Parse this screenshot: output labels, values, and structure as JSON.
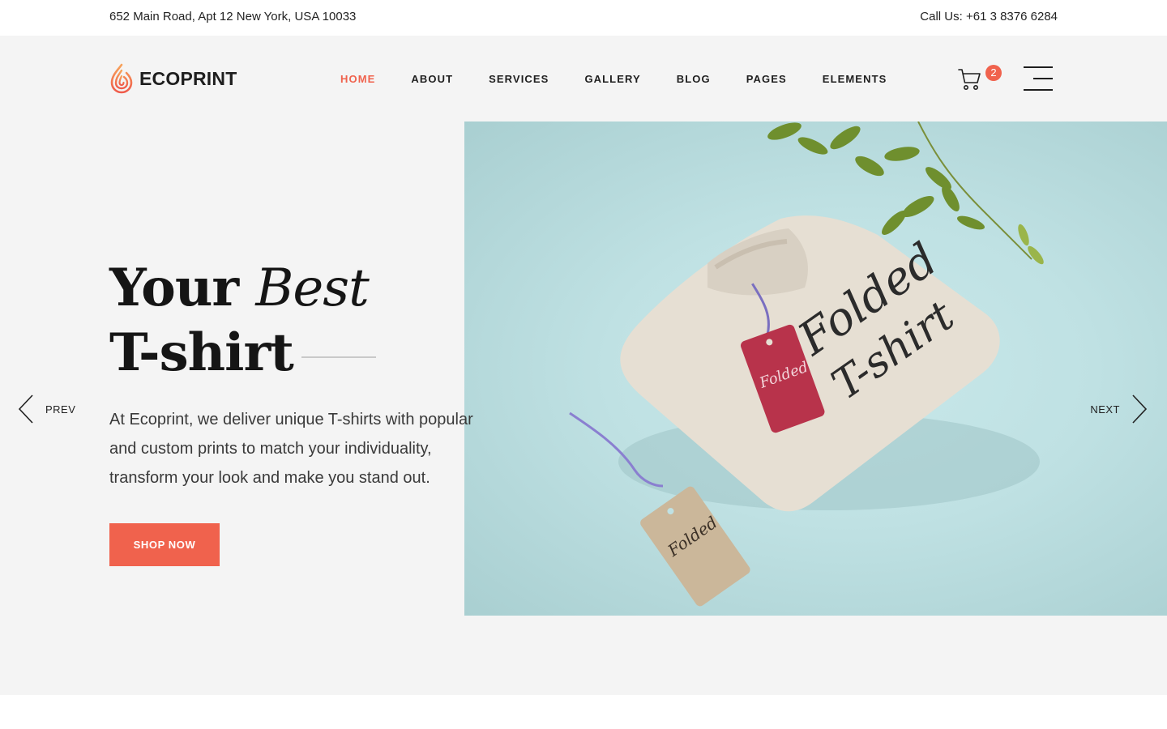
{
  "topbar": {
    "address": "652 Main Road, Apt 12 New York, USA 10033",
    "phone": "Call Us: +61 3 8376 6284"
  },
  "brand": {
    "name": "ECOPRINT",
    "logo_icon": "flame-drop-icon",
    "accent_color": "#f0624d"
  },
  "nav": {
    "items": [
      {
        "label": "HOME",
        "active": true
      },
      {
        "label": "ABOUT"
      },
      {
        "label": "SERVICES"
      },
      {
        "label": "GALLERY"
      },
      {
        "label": "BLOG"
      },
      {
        "label": "PAGES"
      },
      {
        "label": "ELEMENTS"
      }
    ]
  },
  "cart": {
    "count": "2",
    "icon": "cart-icon"
  },
  "menu": {
    "icon": "hamburger-menu-icon"
  },
  "hero": {
    "title_word1": "Your",
    "title_word2": "Best",
    "title_line2": "T-shirt",
    "description": "At Ecoprint, we deliver unique T-shirts with popular and custom prints to match your individuality, transform your look and make you stand out.",
    "button_label": "SHOP NOW",
    "image_icon": "folded-tshirt-mockup-image",
    "image_bg_color": "#c3e3e5"
  },
  "slider": {
    "prev_label": "PREV",
    "next_label": "NEXT"
  }
}
